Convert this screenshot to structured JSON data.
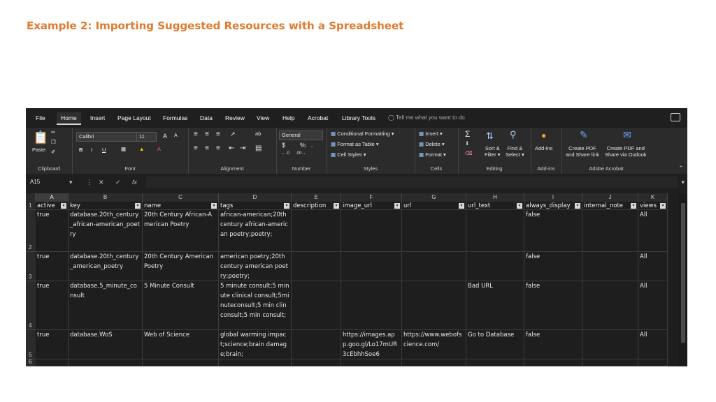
{
  "slide": {
    "title": "Example 2: Importing Suggested Resources with a Spreadsheet"
  },
  "menu": {
    "items": [
      "File",
      "Home",
      "Insert",
      "Page Layout",
      "Formulas",
      "Data",
      "Review",
      "View",
      "Help",
      "Acrobat",
      "Library Tools"
    ],
    "active": "Home",
    "tell_me": "Tell me what you want to do"
  },
  "ribbon": {
    "clipboard": {
      "label": "Clipboard",
      "paste": "Paste"
    },
    "font": {
      "label": "Font",
      "name": "Calibri",
      "size": "11",
      "bold": "B",
      "italic": "I",
      "underline": "U",
      "grow": "A",
      "shrink": "A"
    },
    "alignment": {
      "label": "Alignment"
    },
    "number": {
      "label": "Number",
      "format": "General",
      "currency": "$",
      "percent": "%"
    },
    "styles": {
      "label": "Styles",
      "conditional": "Conditional Formatting",
      "format_table": "Format as Table",
      "cell_styles": "Cell Styles"
    },
    "cells": {
      "label": "Cells",
      "insert": "Insert",
      "delete": "Delete",
      "format": "Format"
    },
    "editing": {
      "label": "Editing",
      "sort": "Sort &",
      "filter": "Filter",
      "find": "Find &",
      "select": "Select"
    },
    "addins": {
      "label": "Add-ins",
      "button": "Add-ins"
    },
    "acrobat": {
      "label": "Adobe Acrobat",
      "create_link_1": "Create PDF",
      "create_link_2": "and Share link",
      "create_outlook_1": "Create PDF and",
      "create_outlook_2": "Share via Outlook"
    }
  },
  "formula_bar": {
    "name_box": "A15",
    "fx": "fx",
    "value": ""
  },
  "sheet": {
    "columns": [
      "A",
      "B",
      "C",
      "D",
      "E",
      "F",
      "G",
      "H",
      "I",
      "J",
      "K"
    ],
    "headers": [
      "active",
      "key",
      "name",
      "tags",
      "description",
      "image_url",
      "url",
      "url_text",
      "always_display",
      "internal_note",
      "views"
    ],
    "rows": [
      {
        "num": "2",
        "cells": [
          "true",
          "database.20th_century_african-american_poetry",
          "20th Century African-American Poetry",
          "african-american;20th century african-american poetry;poetry;",
          "",
          "",
          "",
          "",
          "false",
          "",
          "All"
        ]
      },
      {
        "num": "3",
        "cells": [
          "true",
          "database.20th_century_american_poetry",
          "20th Century American Poetry",
          "american poetry;20th century american poetry;poetry;",
          "",
          "",
          "",
          "",
          "false",
          "",
          "All"
        ]
      },
      {
        "num": "4",
        "cells": [
          "true",
          "database.5_minute_consult",
          "5 Minute Consult",
          "5 minute consult;5 minute clinical consult;5minuteconsult;5 min clin consult;5 min consult;",
          "",
          "",
          "",
          "Bad URL",
          "false",
          "",
          "All"
        ]
      },
      {
        "num": "5",
        "cells": [
          "true",
          "database.WoS",
          "Web of Science",
          "global warming impact;science;brain damage;brain;",
          "",
          "https://images.app.goo.gl/Lo17mUR3cEbhhSoe6",
          "https://www.webofscience.com/",
          "Go to Database",
          "false",
          "",
          "All"
        ]
      },
      {
        "num": "6",
        "cells": [
          "",
          "",
          "",
          "",
          "",
          "",
          "",
          "",
          "",
          "",
          ""
        ]
      }
    ]
  }
}
